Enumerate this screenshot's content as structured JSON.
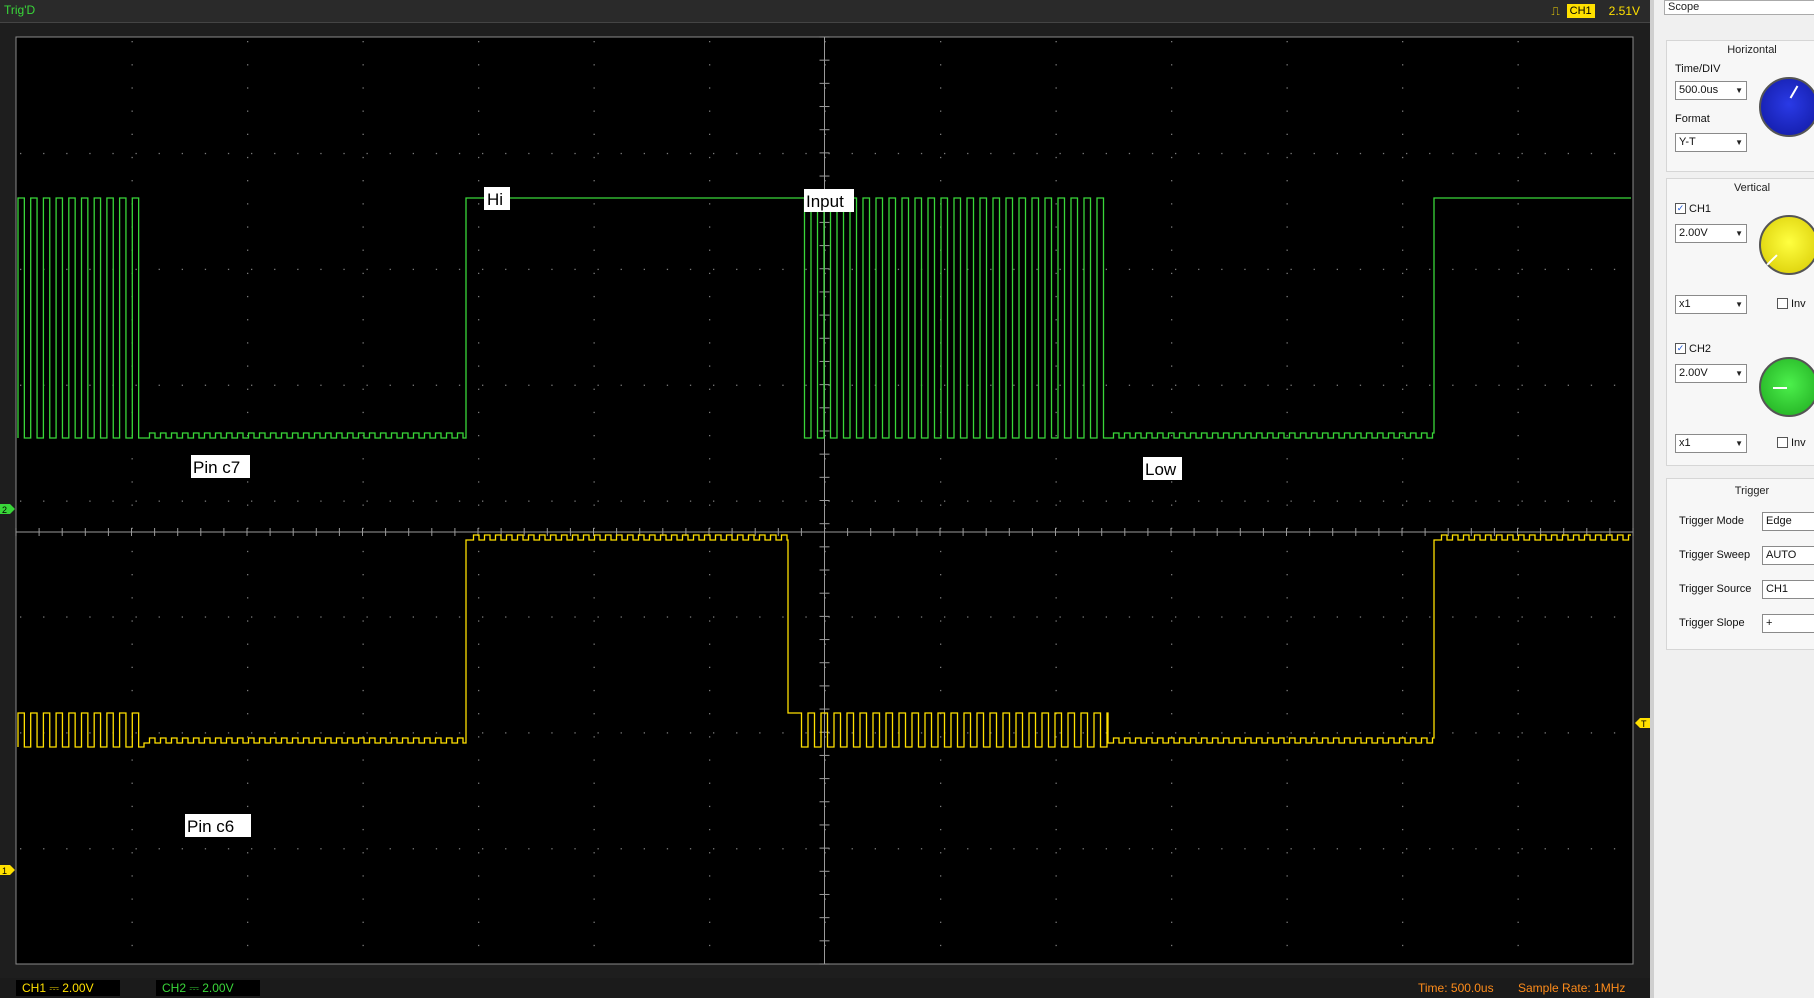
{
  "header": {
    "trigger_status": "Trig'D",
    "trigger_channel": "CH1",
    "trigger_level": "2.51V"
  },
  "screen": {
    "annotations": [
      "Hi",
      "Input",
      "Pin c7",
      "Low",
      "Pin c6"
    ],
    "ch2_marker": "2",
    "ch1_marker": "1",
    "trigger_marker": "T"
  },
  "status_bar": {
    "ch1": "CH1 ⎓  2.00V",
    "ch2": "CH2 ⎓  2.00V",
    "time": "Time: 500.0us",
    "sample_rate": "Sample Rate: 1MHz"
  },
  "panel": {
    "title": "Scope",
    "horizontal": {
      "title": "Horizontal",
      "time_div_label": "Time/DIV",
      "time_div_value": "500.0us",
      "format_label": "Format",
      "format_value": "Y-T"
    },
    "vertical": {
      "title": "Vertical",
      "ch1_label": "CH1",
      "ch1_volts": "2.00V",
      "ch1_probe": "x1",
      "ch1_invert_label": "Inv",
      "ch2_label": "CH2",
      "ch2_volts": "2.00V",
      "ch2_probe": "x1",
      "ch2_invert_label": "Inv"
    },
    "trigger": {
      "title": "Trigger",
      "mode_label": "Trigger Mode",
      "mode_value": "Edge",
      "sweep_label": "Trigger Sweep",
      "sweep_value": "AUTO",
      "source_label": "Trigger Source",
      "source_value": "CH1",
      "slope_label": "Trigger Slope",
      "slope_value": "+"
    }
  },
  "colors": {
    "ch1": "#ffe000",
    "ch2": "#39d639",
    "status_orange": "#ff8c1a",
    "knob_horizontal": "#1e2bd6",
    "knob_ch1": "#f2e600",
    "knob_ch2": "#2ed62e"
  },
  "icons": {
    "trigger_edge": "rising-edge-icon",
    "dropdown": "chevron-down-icon"
  }
}
